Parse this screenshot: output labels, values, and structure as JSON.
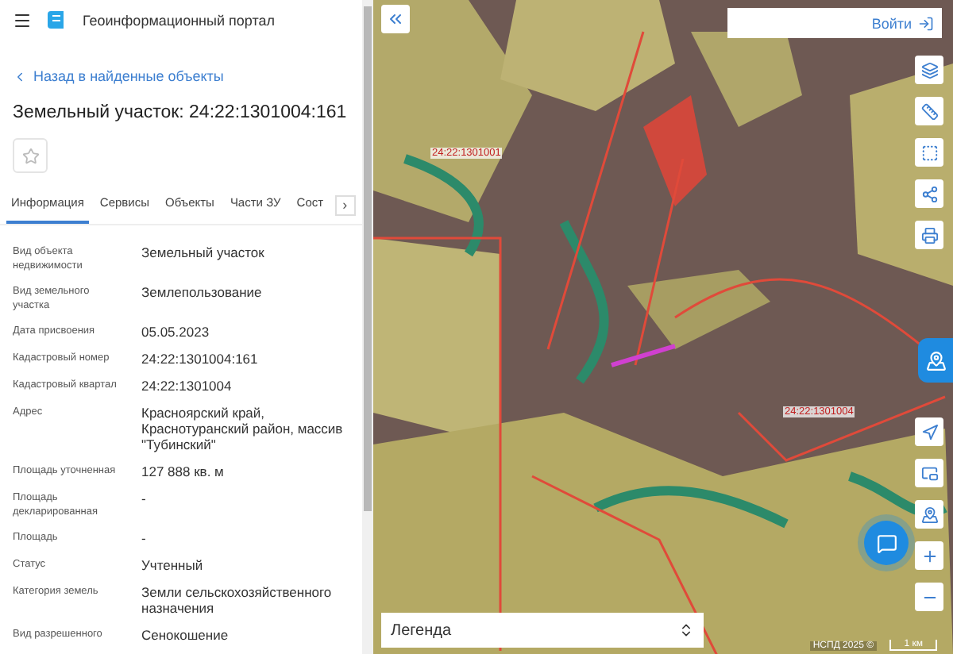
{
  "header": {
    "title": "Геоинформационный портал"
  },
  "back_link": "Назад в найденные объекты",
  "object_title": "Земельный участок: 24:22:1301004:161",
  "favorite": {
    "selected": false
  },
  "tabs": [
    {
      "label": "Информация",
      "selected": true
    },
    {
      "label": "Сервисы",
      "selected": false
    },
    {
      "label": "Объекты",
      "selected": false
    },
    {
      "label": "Части ЗУ",
      "selected": false
    },
    {
      "label": "Сост",
      "selected": false
    }
  ],
  "tabs_scroll": "›",
  "fields": [
    {
      "label": "Вид объекта недвижимости",
      "value": "Земельный участок"
    },
    {
      "label": "Вид земельного участка",
      "value": "Землепользование"
    },
    {
      "label": "Дата присвоения",
      "value": "05.05.2023"
    },
    {
      "label": "Кадастровый номер",
      "value": "24:22:1301004:161"
    },
    {
      "label": "Кадастровый квартал",
      "value": "24:22:1301004"
    },
    {
      "label": "Адрес",
      "value": "Красноярский край, Краснотуранский район, массив \"Тубинский\""
    },
    {
      "label": "Площадь уточненная",
      "value": "127 888 кв. м"
    },
    {
      "label": "Площадь декларированная",
      "value": "-"
    },
    {
      "label": "Площадь",
      "value": "-"
    },
    {
      "label": "Статус",
      "value": "Учтенный"
    },
    {
      "label": "Категория земель",
      "value": "Земли сельскохозяйственного назначения"
    },
    {
      "label": "Вид разрешенного",
      "value": "Сенокошение"
    }
  ],
  "map": {
    "login": "Войти",
    "labels": [
      {
        "text": "24:22:1301001"
      },
      {
        "text": "24:22:1301004"
      }
    ],
    "legend": "Легенда",
    "attribution": "НСПД 2025 ©",
    "scale": "1 км"
  }
}
